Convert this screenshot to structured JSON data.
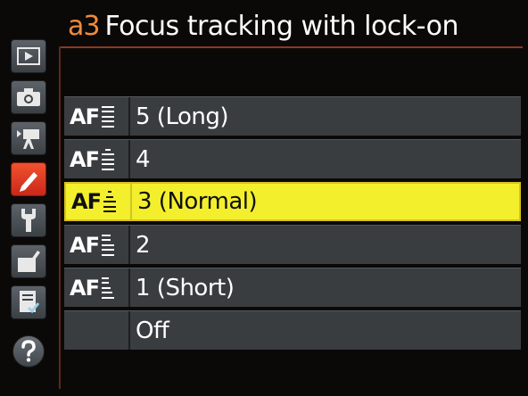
{
  "header": {
    "code": "a3",
    "title": "Focus tracking with lock-on"
  },
  "sidebar": {
    "items": [
      {
        "name": "playback-menu",
        "icon": "play-icon"
      },
      {
        "name": "shooting-menu",
        "icon": "camera-icon"
      },
      {
        "name": "movie-menu",
        "icon": "movie-camera-icon"
      },
      {
        "name": "custom-settings-menu",
        "icon": "pencil-icon",
        "active": true
      },
      {
        "name": "setup-menu",
        "icon": "wrench-icon"
      },
      {
        "name": "retouch-menu",
        "icon": "retouch-brush-icon"
      },
      {
        "name": "my-menu",
        "icon": "my-menu-icon"
      },
      {
        "name": "help",
        "icon": "help-icon"
      }
    ]
  },
  "options": [
    {
      "af": "AF",
      "value": "5 (Long)",
      "level": 5,
      "selected": false
    },
    {
      "af": "AF",
      "value": "4",
      "level": 4,
      "selected": false
    },
    {
      "af": "AF",
      "value": "3 (Normal)",
      "level": 3,
      "selected": true
    },
    {
      "af": "AF",
      "value": "2",
      "level": 2,
      "selected": false
    },
    {
      "af": "AF",
      "value": "1 (Short)",
      "level": 1,
      "selected": false
    },
    {
      "af": "",
      "value": "Off",
      "level": 0,
      "selected": false
    }
  ],
  "colors": {
    "accent_orange": "#f08a3c",
    "selected_yellow": "#f4ef2c",
    "active_tab_red": "#e03a22",
    "row_gray": "#3a3d40"
  }
}
